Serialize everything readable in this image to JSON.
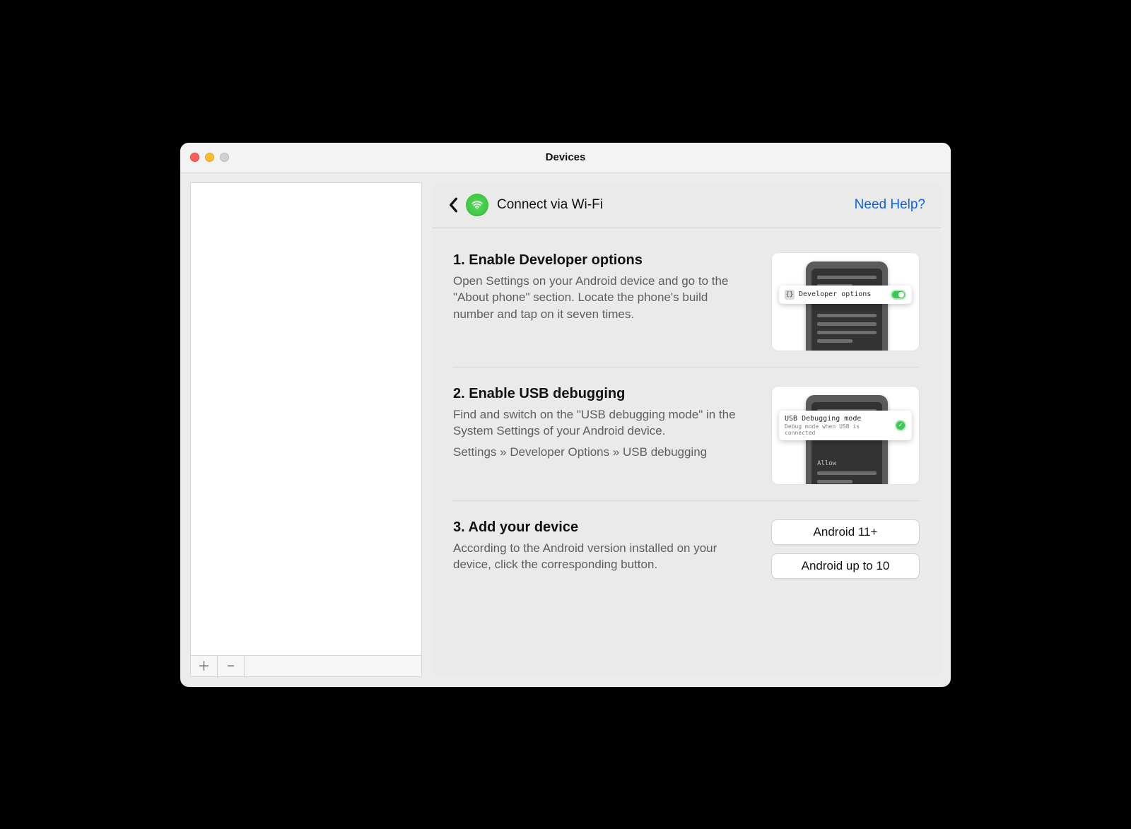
{
  "window": {
    "title": "Devices"
  },
  "header": {
    "title": "Connect via Wi-Fi",
    "help_link": "Need Help?"
  },
  "steps": [
    {
      "title": "1. Enable Developer options",
      "desc": "Open Settings on your Android device and go to the \"About phone\" section. Locate the phone's build number and tap on it seven times.",
      "overlay_label": "Developer options"
    },
    {
      "title": "2. Enable USB debugging",
      "desc": "Find and switch on the \"USB debugging mode\" in the System Settings of your Android device.",
      "path": "Settings » Developer Options » USB debugging",
      "overlay_label": "USB Debugging mode",
      "overlay_sub": "Debug mode when USB is connected",
      "allow_label": "Allow"
    },
    {
      "title": "3. Add your device",
      "desc": "According to the Android version installed on your device, click the corresponding button.",
      "btn1": "Android 11+",
      "btn2": "Android up to 10"
    }
  ]
}
